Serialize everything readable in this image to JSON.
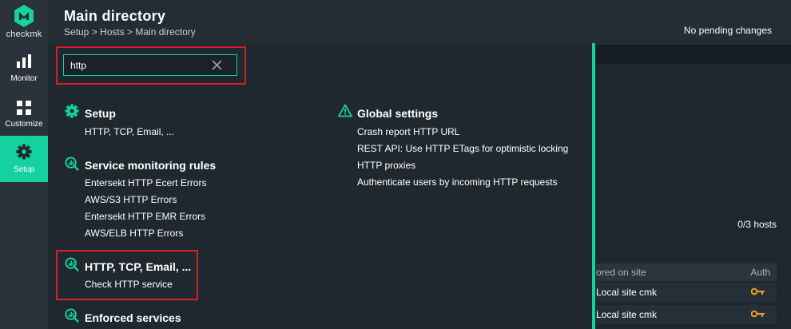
{
  "app": {
    "logo_text": "checkmk",
    "accent_color": "#15d1a0"
  },
  "sidebar": {
    "items": [
      {
        "label": "Monitor",
        "icon": "bar-chart-icon"
      },
      {
        "label": "Customize",
        "icon": "grid-icon"
      },
      {
        "label": "Setup",
        "icon": "gear-icon",
        "active": true
      }
    ]
  },
  "header": {
    "title": "Main directory",
    "breadcrumb": "Setup > Hosts > Main directory",
    "status": "No pending changes"
  },
  "search": {
    "value": "http",
    "placeholder": ""
  },
  "results": {
    "left": [
      {
        "title": "Setup",
        "icon": "gear-icon",
        "items": [
          "HTTP, TCP, Email, ..."
        ]
      },
      {
        "title": "Service monitoring rules",
        "icon": "service-rules-icon",
        "items": [
          "Entersekt HTTP Ecert Errors",
          "AWS/S3 HTTP Errors",
          "Entersekt HTTP EMR Errors",
          "AWS/ELB HTTP Errors"
        ]
      },
      {
        "title": "HTTP, TCP, Email, ...",
        "icon": "service-rules-icon",
        "items": [
          "Check HTTP service"
        ]
      },
      {
        "title": "Enforced services",
        "icon": "service-rules-icon",
        "items": []
      }
    ],
    "right": [
      {
        "title": "Global settings",
        "icon": "warning-icon",
        "items": [
          "Crash report HTTP URL",
          "REST API: Use HTTP ETags for optimistic locking",
          "HTTP proxies",
          "Authenticate users by incoming HTTP requests"
        ]
      }
    ]
  },
  "background": {
    "hosts_count": "0/3 hosts",
    "table": {
      "col1": "ored on site",
      "col2": "Auth",
      "rows": [
        "Local site cmk",
        "Local site cmk"
      ]
    }
  }
}
